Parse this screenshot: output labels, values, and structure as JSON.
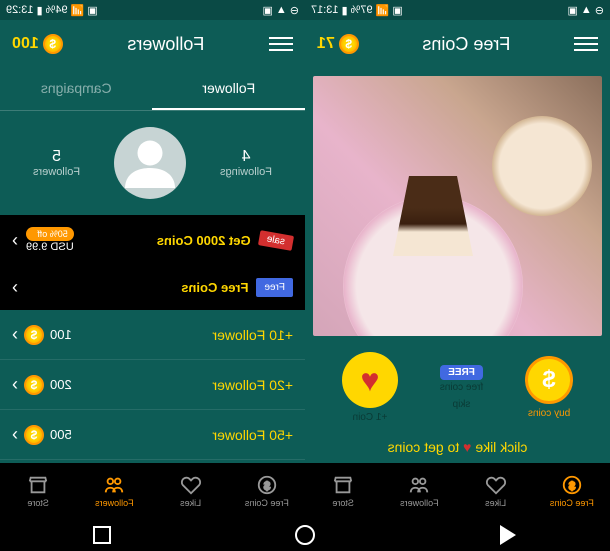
{
  "left": {
    "status": {
      "time": "13:17",
      "battery": "97%"
    },
    "header": {
      "title": "Free Coins",
      "coins": "71"
    },
    "actions": {
      "like": {
        "label": "+1 Coin"
      },
      "buy": {
        "label": "buy coins"
      },
      "free": {
        "badge": "FREE",
        "text": "free coins",
        "skip": "skip"
      }
    },
    "cta": {
      "prefix": "click like ",
      "suffix": " to get coins"
    },
    "nav": {
      "items": [
        {
          "label": "Free Coins"
        },
        {
          "label": "Likes"
        },
        {
          "label": "Followers"
        },
        {
          "label": "Store"
        }
      ]
    }
  },
  "right": {
    "status": {
      "time": "13:29",
      "battery": "94%"
    },
    "header": {
      "title": "Followers",
      "coins": "100"
    },
    "tabs": {
      "follower": "Follower",
      "campaigns": "Campaigns"
    },
    "profile": {
      "followings": {
        "count": "4",
        "label": "Followings"
      },
      "followers": {
        "count": "5",
        "label": "Followers"
      }
    },
    "offers": [
      {
        "tag": "sale",
        "title": "Get 2000 Coins",
        "discount": "50% off",
        "price": "USD 9.99"
      },
      {
        "tag": "Free",
        "title": "Free Coins"
      }
    ],
    "packages": [
      {
        "name": "+10 Follower",
        "coins": "100"
      },
      {
        "name": "+20 Follower",
        "coins": "200"
      },
      {
        "name": "+50 Follower",
        "coins": "500"
      }
    ],
    "nav": {
      "items": [
        {
          "label": "Free Coins"
        },
        {
          "label": "Likes"
        },
        {
          "label": "Followers"
        },
        {
          "label": "Store"
        }
      ]
    }
  }
}
